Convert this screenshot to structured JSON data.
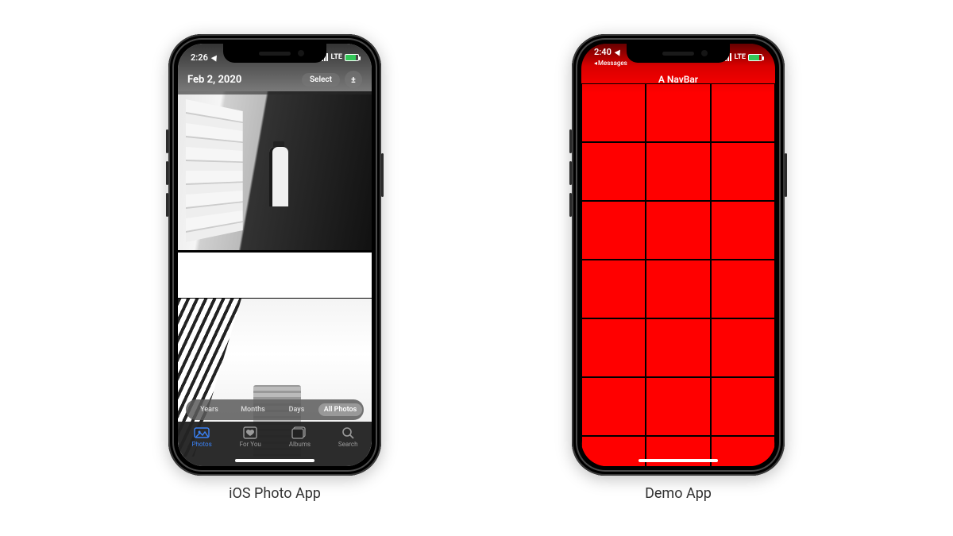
{
  "left": {
    "caption": "iOS Photo App",
    "status": {
      "time": "2:26",
      "carrier": "LTE"
    },
    "header": {
      "date": "Feb 2, 2020",
      "select_label": "Select",
      "options_icon": "±"
    },
    "segments": [
      "Years",
      "Months",
      "Days",
      "All Photos"
    ],
    "segment_active_index": 3,
    "tabs": [
      {
        "label": "Photos",
        "icon": "photos"
      },
      {
        "label": "For You",
        "icon": "foryou"
      },
      {
        "label": "Albums",
        "icon": "albums"
      },
      {
        "label": "Search",
        "icon": "search"
      }
    ],
    "tab_active_index": 0
  },
  "right": {
    "caption": "Demo App",
    "status": {
      "time": "2:40",
      "back_label": "Messages",
      "carrier": "LTE"
    },
    "nav_title": "A NavBar",
    "grid": {
      "cols": 3,
      "rows": 7
    }
  }
}
